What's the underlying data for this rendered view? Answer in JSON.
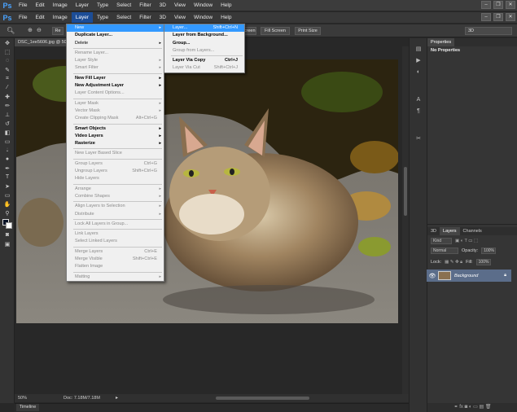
{
  "app": {
    "logo": "Ps"
  },
  "menubar": [
    "File",
    "Edit",
    "Image",
    "Layer",
    "Type",
    "Select",
    "Filter",
    "3D",
    "View",
    "Window",
    "Help"
  ],
  "active_menu": "Layer",
  "options_bar": {
    "buttons": [
      "Fit Screen",
      "Fill Screen",
      "Print Size"
    ],
    "right_field": "3D",
    "left_partial": "Re"
  },
  "document": {
    "tab_title": "DSC_1ee5606.jpg @ 50",
    "zoom": "50%",
    "doc_size": "Doc: 7.18M/7.18M"
  },
  "timeline_label": "Timeline",
  "properties_panel": {
    "title": "Properties",
    "content": "No Properties"
  },
  "layers_panel": {
    "tabs": [
      "3D",
      "Layers",
      "Channels"
    ],
    "kind_label": "Kind",
    "blend_mode": "Normal",
    "opacity_label": "Opacity:",
    "opacity_value": "100%",
    "lock_label": "Lock:",
    "fill_label": "Fill:",
    "fill_value": "100%",
    "layer_name": "Background"
  },
  "layer_menu": [
    {
      "label": "New",
      "submenu": true,
      "highlight": true,
      "bold": true
    },
    {
      "label": "Duplicate Layer...",
      "bold": true
    },
    {
      "label": "Delete",
      "submenu": true
    },
    {
      "sep": true
    },
    {
      "label": "Rename Layer...",
      "disabled": true
    },
    {
      "label": "Layer Style",
      "submenu": true,
      "disabled": true
    },
    {
      "label": "Smart Filter",
      "submenu": true,
      "disabled": true
    },
    {
      "sep": true
    },
    {
      "label": "New Fill Layer",
      "submenu": true,
      "bold": true
    },
    {
      "label": "New Adjustment Layer",
      "submenu": true,
      "bold": true
    },
    {
      "label": "Layer Content Options...",
      "disabled": true
    },
    {
      "sep": true
    },
    {
      "label": "Layer Mask",
      "submenu": true,
      "disabled": true
    },
    {
      "label": "Vector Mask",
      "submenu": true,
      "disabled": true
    },
    {
      "label": "Create Clipping Mask",
      "shortcut": "Alt+Ctrl+G",
      "disabled": true
    },
    {
      "sep": true
    },
    {
      "label": "Smart Objects",
      "submenu": true,
      "bold": true
    },
    {
      "label": "Video Layers",
      "submenu": true,
      "bold": true
    },
    {
      "label": "Rasterize",
      "submenu": true,
      "bold": true
    },
    {
      "sep": true
    },
    {
      "label": "New Layer Based Slice",
      "disabled": true
    },
    {
      "sep": true
    },
    {
      "label": "Group Layers",
      "shortcut": "Ctrl+G",
      "disabled": true
    },
    {
      "label": "Ungroup Layers",
      "shortcut": "Shift+Ctrl+G",
      "disabled": true
    },
    {
      "label": "Hide Layers",
      "disabled": true
    },
    {
      "sep": true
    },
    {
      "label": "Arrange",
      "submenu": true,
      "disabled": true
    },
    {
      "label": "Combine Shapes",
      "submenu": true,
      "disabled": true
    },
    {
      "sep": true
    },
    {
      "label": "Align Layers to Selection",
      "submenu": true,
      "disabled": true
    },
    {
      "label": "Distribute",
      "submenu": true,
      "disabled": true
    },
    {
      "sep": true
    },
    {
      "label": "Lock All Layers in Group...",
      "disabled": true
    },
    {
      "sep": true
    },
    {
      "label": "Link Layers",
      "disabled": true
    },
    {
      "label": "Select Linked Layers",
      "disabled": true
    },
    {
      "sep": true
    },
    {
      "label": "Merge Layers",
      "shortcut": "Ctrl+E",
      "disabled": true
    },
    {
      "label": "Merge Visible",
      "shortcut": "Shift+Ctrl+E",
      "disabled": true
    },
    {
      "label": "Flatten Image",
      "disabled": true
    },
    {
      "sep": true
    },
    {
      "label": "Matting",
      "submenu": true,
      "disabled": true
    }
  ],
  "new_submenu": [
    {
      "label": "Layer...",
      "shortcut": "Shift+Ctrl+N",
      "highlight": true
    },
    {
      "label": "Layer from Background...",
      "bold": true
    },
    {
      "label": "Group...",
      "bold": true
    },
    {
      "label": "Group from Layers...",
      "disabled": true
    },
    {
      "sep": true
    },
    {
      "label": "Layer Via Copy",
      "shortcut": "Ctrl+J",
      "bold": true
    },
    {
      "label": "Layer Via Cut",
      "shortcut": "Shift+Ctrl+J",
      "disabled": true
    }
  ]
}
